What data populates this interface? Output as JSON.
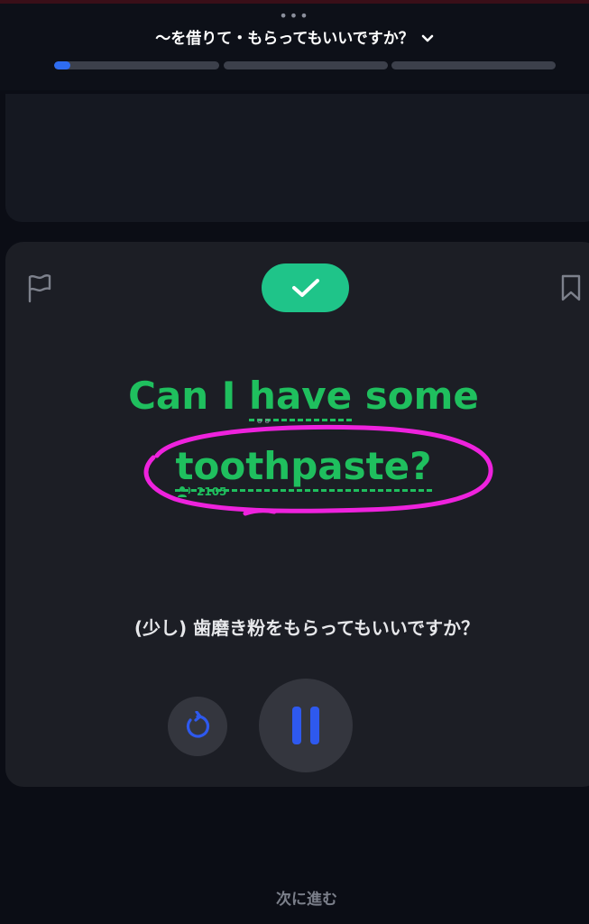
{
  "header": {
    "more_dots": "•••",
    "lesson_title": "〜を借りて・もらってもいいですか？",
    "progress_fraction": 0.1
  },
  "card": {
    "sentence_line1_pre": "Can I ",
    "sentence_line1_word": "have",
    "sentence_line1_post": " some",
    "sentence_line2": "toothpaste?",
    "small_label": "ə ə",
    "listen_count": "2105",
    "translation": "(少し) 歯磨き粉をもらってもいいですか？"
  },
  "footer": {
    "next_label": "次に進む"
  },
  "colors": {
    "accent_green": "#1fbf5e",
    "check_green": "#1fc489",
    "progress_blue": "#2e6cf0",
    "annotation_magenta": "#ee22dd"
  },
  "icons": [
    "chevron-down-icon",
    "flag-icon",
    "bookmark-icon",
    "check-icon",
    "speaker-person-icon",
    "replay-icon",
    "pause-icon"
  ]
}
